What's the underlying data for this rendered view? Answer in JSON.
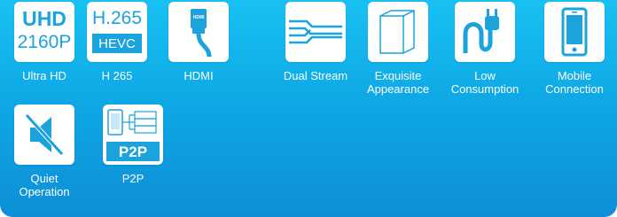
{
  "features": [
    {
      "icon": "uhd-2160p-icon",
      "badge_top": "UHD",
      "badge_bottom": "2160P",
      "label": "Ultra HD"
    },
    {
      "icon": "h265-hevc-icon",
      "badge_top": "H.265",
      "badge_bottom": "HEVC",
      "label": "H 265"
    },
    {
      "icon": "hdmi-cable-icon",
      "badge_top": "HDMI",
      "label": "HDMI"
    },
    {
      "icon": "dual-stream-icon",
      "label": "Dual Stream"
    },
    {
      "icon": "exquisite-box-icon",
      "label": "Exquisite\nAppearance"
    },
    {
      "icon": "power-plug-icon",
      "label": "Low\nConsumption"
    },
    {
      "icon": "mobile-phone-icon",
      "label": "Mobile\nConnection"
    },
    {
      "icon": "mute-speaker-icon",
      "label": "Quiet\nOperation"
    },
    {
      "icon": "p2p-icon",
      "badge_top": "P2P",
      "label": "P2P"
    }
  ],
  "colors": {
    "panel_top": "#18c1f3",
    "panel_bottom": "#0d8fd7",
    "tile_bg": "#ffffff",
    "icon_blue": "#1aa3dd",
    "text_white": "#ffffff"
  }
}
